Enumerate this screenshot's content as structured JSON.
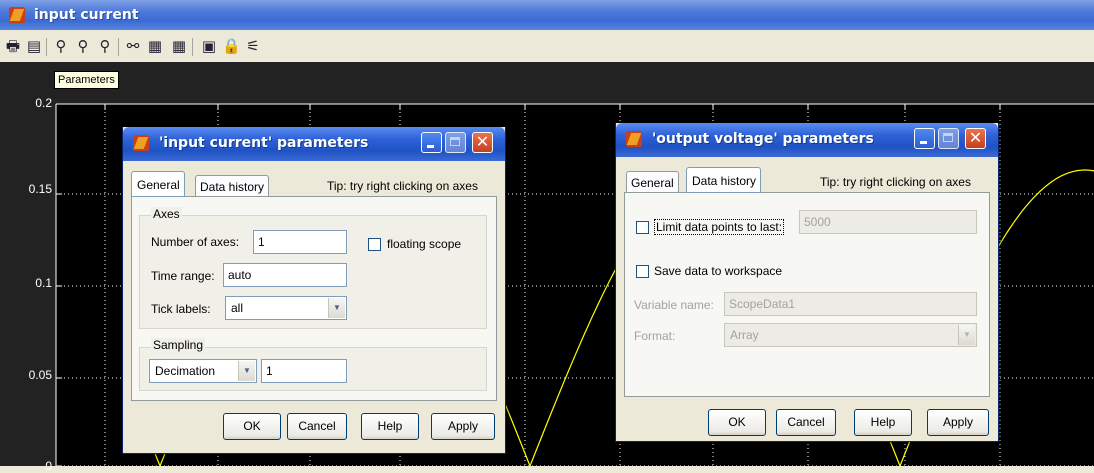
{
  "window": {
    "title": "input current"
  },
  "toolbar": {
    "icons": [
      "print-icon",
      "parameters-icon",
      "zoom-icon",
      "zoom-x-icon",
      "zoom-y-icon",
      "autoscale-icon",
      "save-axes-icon",
      "restore-axes-icon",
      "floating-scope-icon",
      "lock-axes-icon",
      "signal-selection-icon"
    ]
  },
  "tooltip": {
    "text": "Parameters"
  },
  "plot": {
    "background": "#000000",
    "trace_color": "#ffff00",
    "y_ticks": [
      "0.2",
      "0.15",
      "0.1",
      "0.05",
      "0"
    ]
  },
  "dialog_input": {
    "title": "'input current' parameters",
    "tabs": [
      "General",
      "Data history"
    ],
    "tip": "Tip: try right clicking on axes",
    "axes_group": "Axes",
    "num_axes_label": "Number of axes:",
    "num_axes_value": "1",
    "floating_scope_label": "floating scope",
    "time_range_label": "Time range:",
    "time_range_value": "auto",
    "tick_labels_label": "Tick labels:",
    "tick_labels_value": "all",
    "sampling_group": "Sampling",
    "sampling_mode": "Decimation",
    "sampling_value": "1",
    "buttons": [
      "OK",
      "Cancel",
      "Help",
      "Apply"
    ]
  },
  "dialog_output": {
    "title": "'output voltage' parameters",
    "tabs": [
      "General",
      "Data history"
    ],
    "tip": "Tip: try right clicking on axes",
    "limit_label": "Limit data points to last:",
    "limit_value": "5000",
    "save_label": "Save data to workspace",
    "var_name_label": "Variable name:",
    "var_name_value": "ScopeData1",
    "format_label": "Format:",
    "format_value": "Array",
    "buttons": [
      "OK",
      "Cancel",
      "Help",
      "Apply"
    ]
  }
}
